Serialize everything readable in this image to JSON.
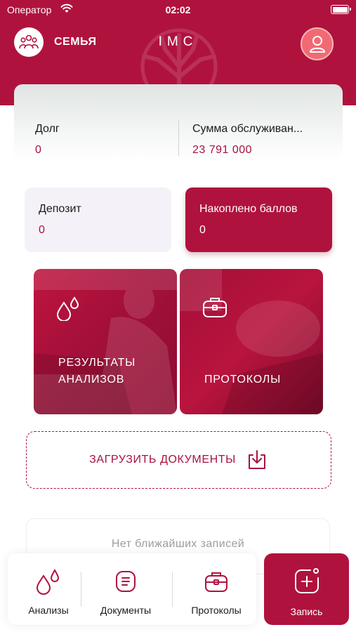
{
  "status_bar": {
    "carrier": "Оператор",
    "time": "02:02"
  },
  "header": {
    "family_label": "СЕМЬЯ",
    "brand": "IMC"
  },
  "balance": {
    "debt_label": "Долг",
    "debt_value": "0",
    "service_label": "Сумма обслуживан...",
    "service_value": "23 791 000"
  },
  "deposit": {
    "label": "Депозит",
    "value": "0"
  },
  "points": {
    "label": "Накоплено баллов",
    "value": "0"
  },
  "tiles": {
    "results_line1": "РЕЗУЛЬТАТЫ",
    "results_line2": "АНАЛИЗОВ",
    "protocols": "ПРОТОКОЛЫ"
  },
  "upload": {
    "label": "ЗАГРУЗИТЬ ДОКУМЕНТЫ"
  },
  "records": {
    "empty_text": "Нет ближайших записей"
  },
  "tabbar": {
    "analyses": "Анализы",
    "documents": "Документы",
    "protocols": "Протоколы",
    "record": "Запись"
  },
  "colors": {
    "brand": "#b0123e",
    "accent_text": "#a8123e",
    "profile": "#f16a73",
    "deposit_bg": "#f4f2f8"
  },
  "icons": {
    "family": "people-group-icon",
    "profile": "user-icon",
    "results": "drops-icon",
    "protocols": "medical-bag-icon",
    "upload": "download-tray-icon",
    "documents": "document-list-icon",
    "record": "add-appointment-icon"
  }
}
